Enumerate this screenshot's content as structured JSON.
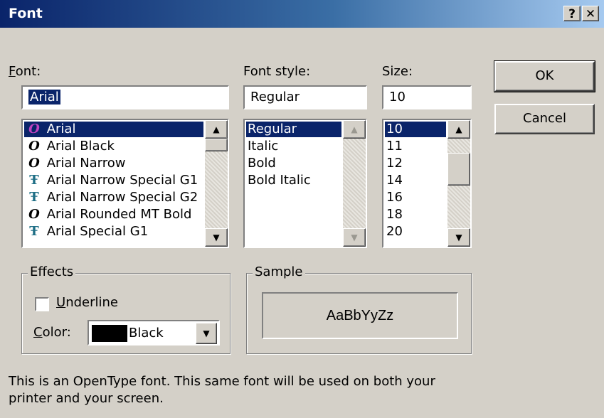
{
  "window": {
    "title": "Font",
    "help_label": "?",
    "close_label": "✕"
  },
  "font": {
    "label": "Font:",
    "input_value": "Arial",
    "items": [
      {
        "label": "Arial",
        "icon": "O",
        "icon_name": "opentype-icon"
      },
      {
        "label": "Arial Black",
        "icon": "O",
        "icon_name": "opentype-icon"
      },
      {
        "label": "Arial Narrow",
        "icon": "O",
        "icon_name": "opentype-icon"
      },
      {
        "label": "Arial Narrow Special G1",
        "icon": "T",
        "icon_name": "truetype-icon"
      },
      {
        "label": "Arial Narrow Special G2",
        "icon": "T",
        "icon_name": "truetype-icon"
      },
      {
        "label": "Arial Rounded MT Bold",
        "icon": "O",
        "icon_name": "opentype-icon"
      },
      {
        "label": "Arial Special G1",
        "icon": "T",
        "icon_name": "truetype-icon"
      }
    ],
    "selected_index": 0
  },
  "style": {
    "label": "Font style:",
    "input_value": "Regular",
    "items": [
      "Regular",
      "Italic",
      "Bold",
      "Bold Italic"
    ],
    "selected_index": 0
  },
  "size": {
    "label": "Size:",
    "input_value": "10",
    "items": [
      "10",
      "11",
      "12",
      "14",
      "16",
      "18",
      "20"
    ],
    "selected_index": 0
  },
  "buttons": {
    "ok": "OK",
    "cancel": "Cancel"
  },
  "effects": {
    "legend": "Effects",
    "underline_label": "Underline",
    "underline_checked": false,
    "color_label": "Color:",
    "color_value": "Black",
    "color_hex": "#000000"
  },
  "sample": {
    "legend": "Sample",
    "text": "AaBbYyZz"
  },
  "description": "This is an OpenType font. This same font will be used on both your printer and your screen.",
  "colors": {
    "title_start": "#0a246a",
    "title_end": "#a6caf0",
    "face": "#d4d0c8",
    "selection": "#0a246a"
  }
}
